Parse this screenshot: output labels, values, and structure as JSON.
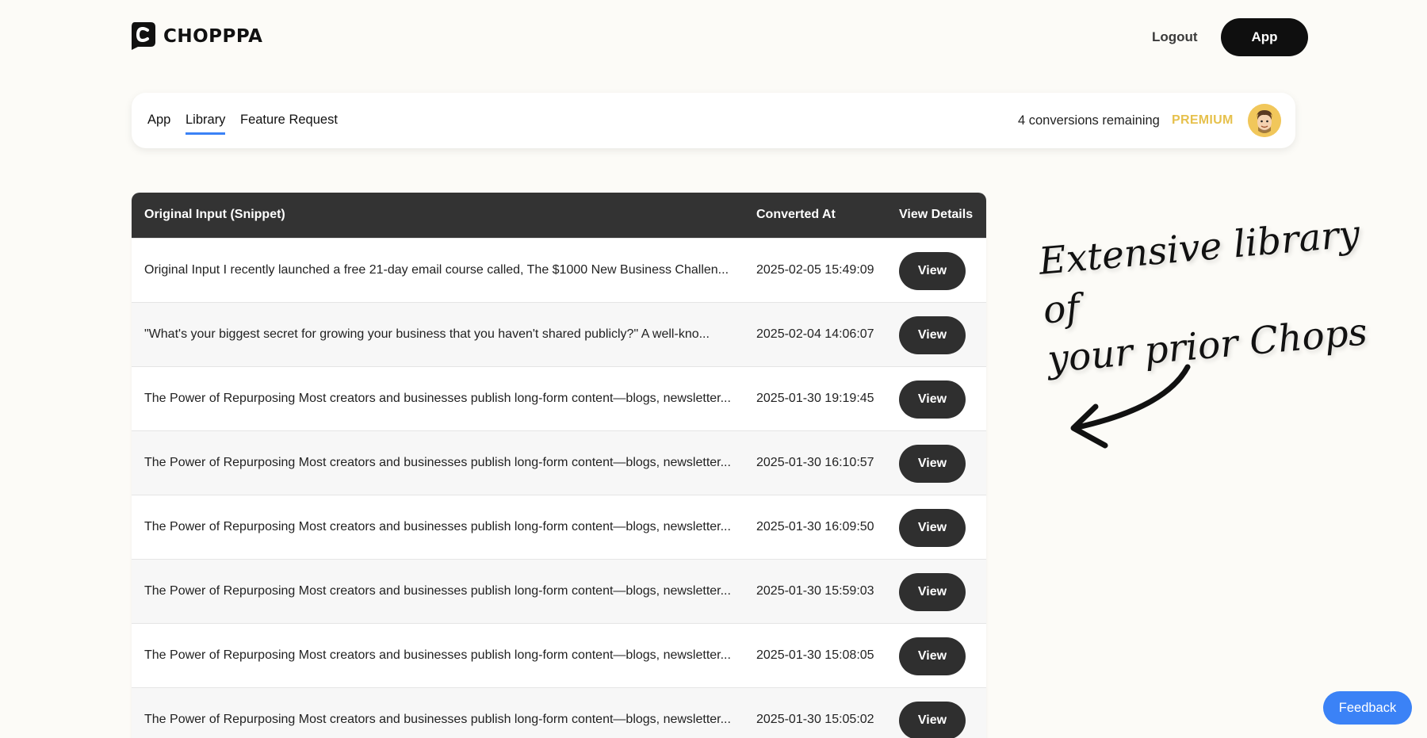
{
  "brand": {
    "name": "CHOPPPA",
    "icon": "chopppa-logo-icon"
  },
  "header": {
    "logout_label": "Logout",
    "app_button_label": "App"
  },
  "nav": {
    "tabs": [
      {
        "label": "App",
        "active": false
      },
      {
        "label": "Library",
        "active": true
      },
      {
        "label": "Feature Request",
        "active": false
      }
    ],
    "conversions_remaining": "4 conversions remaining",
    "plan_badge": "PREMIUM",
    "avatar_icon": "avatar-icon"
  },
  "table": {
    "headers": [
      "Original Input (Snippet)",
      "Converted At",
      "View Details"
    ],
    "view_label": "View",
    "rows": [
      {
        "input": "Original Input I recently launched a free 21-day email course called, The $1000 New Business Challen...",
        "converted_at": "2025-02-05 15:49:09"
      },
      {
        "input": "\"What's your biggest secret for growing your business that you haven't shared publicly?\" A well-kno...",
        "converted_at": "2025-02-04 14:06:07"
      },
      {
        "input": "The Power of Repurposing Most creators and businesses publish long-form content—blogs, newsletter...",
        "converted_at": "2025-01-30 19:19:45"
      },
      {
        "input": "The Power of Repurposing Most creators and businesses publish long-form content—blogs, newsletter...",
        "converted_at": "2025-01-30 16:10:57"
      },
      {
        "input": "The Power of Repurposing Most creators and businesses publish long-form content—blogs, newsletter...",
        "converted_at": "2025-01-30 16:09:50"
      },
      {
        "input": "The Power of Repurposing Most creators and businesses publish long-form content—blogs, newsletter...",
        "converted_at": "2025-01-30 15:59:03"
      },
      {
        "input": "The Power of Repurposing Most creators and businesses publish long-form content—blogs, newsletter...",
        "converted_at": "2025-01-30 15:08:05"
      },
      {
        "input": "The Power of Repurposing Most creators and businesses publish long-form content—blogs, newsletter...",
        "converted_at": "2025-01-30 15:05:02"
      }
    ]
  },
  "annotation": {
    "line1": "Extensive library of",
    "line2": "your prior Chops",
    "arrow_icon": "curved-arrow-icon"
  },
  "feedback_label": "Feedback",
  "colors": {
    "accent_blue": "#3b82f6",
    "premium_gold": "#e6c14d",
    "dark": "#2f2f2f",
    "background": "#fcfbf7"
  }
}
